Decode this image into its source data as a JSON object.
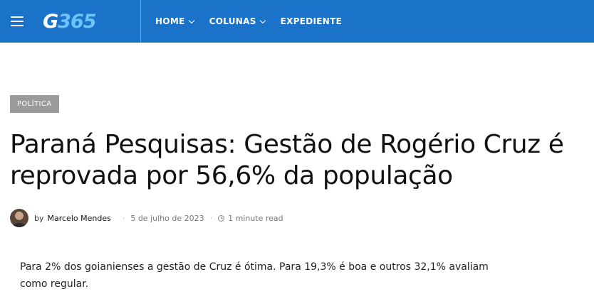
{
  "header": {
    "logo_text_g": "G",
    "logo_text_n": "365",
    "nav": [
      {
        "label": "HOME",
        "has_dropdown": true
      },
      {
        "label": "COLUNAS",
        "has_dropdown": true
      },
      {
        "label": "EXPEDIENTE",
        "has_dropdown": false
      }
    ],
    "colors": {
      "bar": "#1a73c8",
      "logo_accent": "#6ec3ff"
    }
  },
  "article": {
    "category": "POLÍTICA",
    "title": "Paraná Pesquisas: Gestão de Rogério Cruz é reprovada por 56,6% da população",
    "meta": {
      "by": "by",
      "author": "Marcelo Mendes",
      "date": "5 de julho de 2023",
      "read_time": "1 minute read"
    },
    "lead": "Para 2% dos goianienses a gestão de Cruz é ótima. Para 19,3% é boa e outros 32,1% avaliam como regular."
  }
}
